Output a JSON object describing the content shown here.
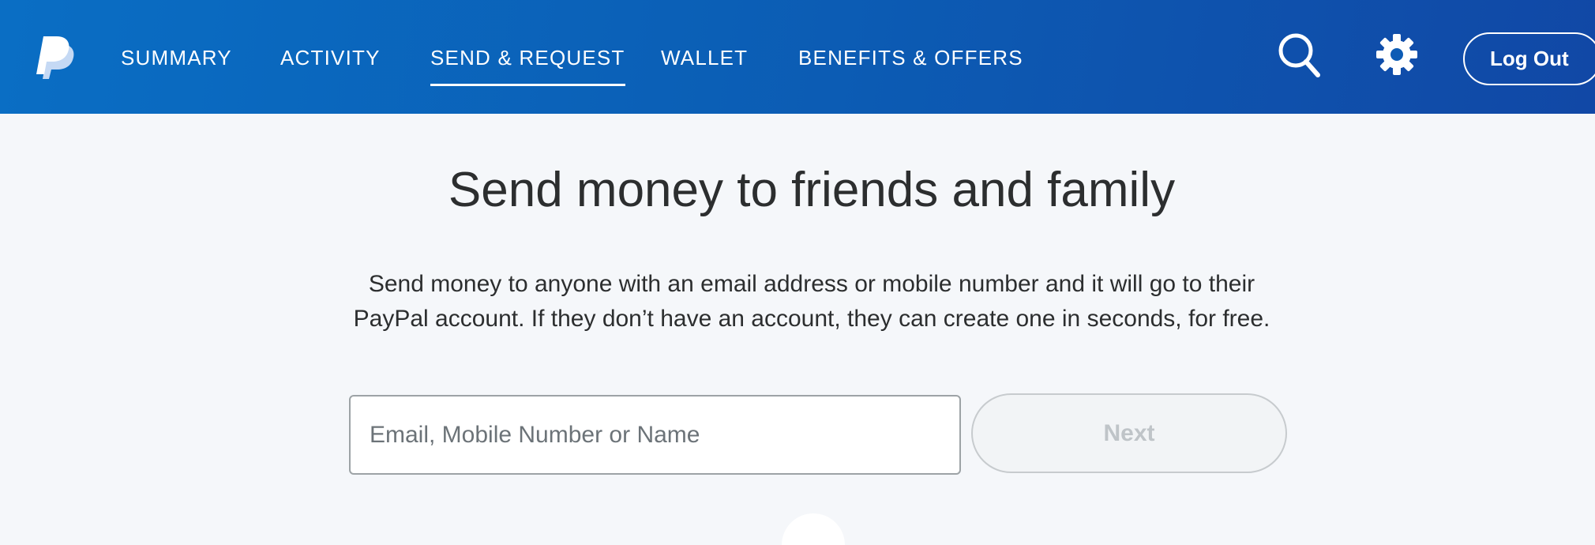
{
  "header": {
    "logo_icon": "paypal-logo-icon",
    "nav": [
      {
        "label": "SUMMARY",
        "active": false
      },
      {
        "label": "ACTIVITY",
        "active": false
      },
      {
        "label": "SEND & REQUEST",
        "active": true
      },
      {
        "label": "WALLET",
        "active": false
      },
      {
        "label": "BENEFITS & OFFERS",
        "active": false
      }
    ],
    "search_icon": "search-icon",
    "settings_icon": "gear-icon",
    "logout_label": "Log Out"
  },
  "main": {
    "title": "Send money to friends and family",
    "description_line1": "Send money to anyone with an email address or mobile number and it will go to their",
    "description_line2": "PayPal account. If they don’t have an account, they can create one in seconds, for free.",
    "recipient_input": {
      "placeholder": "Email, Mobile Number or Name",
      "value": ""
    },
    "next_label": "Next"
  },
  "colors": {
    "header_start": "#0a6ec4",
    "header_end": "#1148a6",
    "page_bg": "#f5f7fa",
    "text": "#2c2e2f",
    "next_disabled_text": "#bfc4c8"
  }
}
